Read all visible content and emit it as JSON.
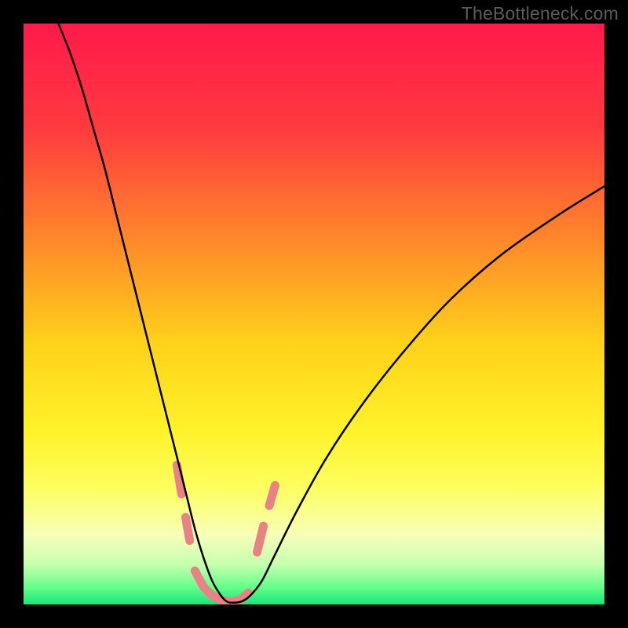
{
  "watermark": "TheBottleneck.com",
  "chart_data": {
    "type": "line",
    "title": "",
    "xlabel": "",
    "ylabel": "",
    "xlim": [
      0,
      100
    ],
    "ylim": [
      0,
      100
    ],
    "grid": false,
    "background_gradient": {
      "stops": [
        {
          "offset": 0.0,
          "color": "#ff1a4a"
        },
        {
          "offset": 0.18,
          "color": "#ff3a3f"
        },
        {
          "offset": 0.38,
          "color": "#ff8b2a"
        },
        {
          "offset": 0.55,
          "color": "#ffd21a"
        },
        {
          "offset": 0.7,
          "color": "#fff22a"
        },
        {
          "offset": 0.8,
          "color": "#fdff60"
        },
        {
          "offset": 0.88,
          "color": "#f7ffb8"
        },
        {
          "offset": 0.93,
          "color": "#c8ffb0"
        },
        {
          "offset": 0.97,
          "color": "#66ff8a"
        },
        {
          "offset": 1.0,
          "color": "#18e57a"
        }
      ]
    },
    "series": [
      {
        "name": "bottleneck-curve",
        "stroke": "#000000",
        "stroke_width": 2.5,
        "x": [
          6.0,
          8.0,
          10.0,
          12.0,
          14.0,
          16.0,
          18.0,
          20.0,
          22.0,
          24.0,
          26.0,
          28.0,
          29.5,
          31.0,
          32.5,
          34.0,
          35.0,
          36.0,
          37.5,
          39.0,
          41.0,
          43.0,
          47.0,
          52.0,
          58.0,
          65.0,
          73.0,
          82.0,
          92.0,
          100.0
        ],
        "y": [
          100.0,
          95.0,
          89.0,
          82.0,
          75.0,
          67.0,
          59.0,
          51.0,
          43.0,
          35.0,
          27.0,
          19.0,
          13.0,
          8.0,
          4.0,
          1.5,
          0.5,
          0.3,
          0.5,
          1.5,
          4.0,
          8.0,
          16.0,
          25.0,
          34.0,
          43.0,
          52.0,
          60.0,
          67.0,
          72.0
        ]
      },
      {
        "name": "highlight-segments",
        "stroke": "#e98284",
        "stroke_width": 11,
        "linecap": "round",
        "segments": [
          {
            "x": [
              26.4,
              27.2
            ],
            "y": [
              24.0,
              19.0
            ]
          },
          {
            "x": [
              27.9,
              28.6
            ],
            "y": [
              15.0,
              11.0
            ]
          },
          {
            "x": [
              29.5,
              31.0,
              32.5,
              34.0,
              35.0,
              36.0,
              37.5,
              38.7
            ],
            "y": [
              5.8,
              3.0,
              1.5,
              0.8,
              0.5,
              0.5,
              0.9,
              2
            ]
          },
          {
            "x": [
              40.2,
              41.3
            ],
            "y": [
              9.0,
              13.5
            ]
          },
          {
            "x": [
              42.3,
              43.3
            ],
            "y": [
              17.0,
              20.5
            ]
          }
        ]
      }
    ]
  }
}
